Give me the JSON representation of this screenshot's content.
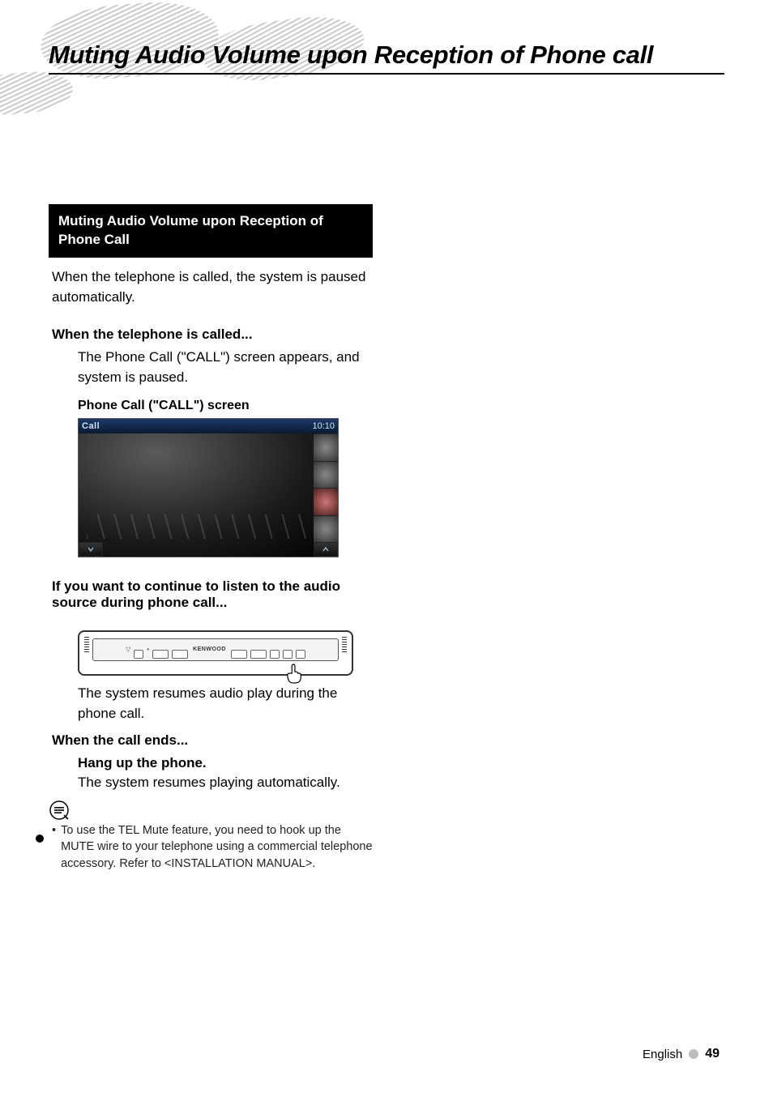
{
  "title": "Muting Audio Volume upon Reception of Phone call",
  "section_header": "Muting Audio Volume upon Reception of Phone Call",
  "intro": "When the telephone is called, the system is paused automatically.",
  "step1_heading": "When the telephone is called...",
  "step1_body": "The Phone Call (\"CALL\") screen appears, and system is paused.",
  "screen_caption": "Phone Call (\"CALL\") screen",
  "call_screen": {
    "label": "Call",
    "clock": "10:10"
  },
  "panel_brand": "KENWOOD",
  "step2_heading": "If you want to continue to listen to the audio source during phone call...",
  "step2_body": "The system resumes audio play during the phone call.",
  "step3_heading": "When the call ends...",
  "step3_sub_bold": "Hang up the phone.",
  "step3_body": "The system resumes playing automatically.",
  "note_bullet": "•",
  "note_text": "To use the TEL Mute feature, you need to hook up the MUTE wire to your telephone using a commercial telephone accessory.  Refer to <INSTALLATION MANUAL>.",
  "footer_lang": "English",
  "footer_page": "49"
}
